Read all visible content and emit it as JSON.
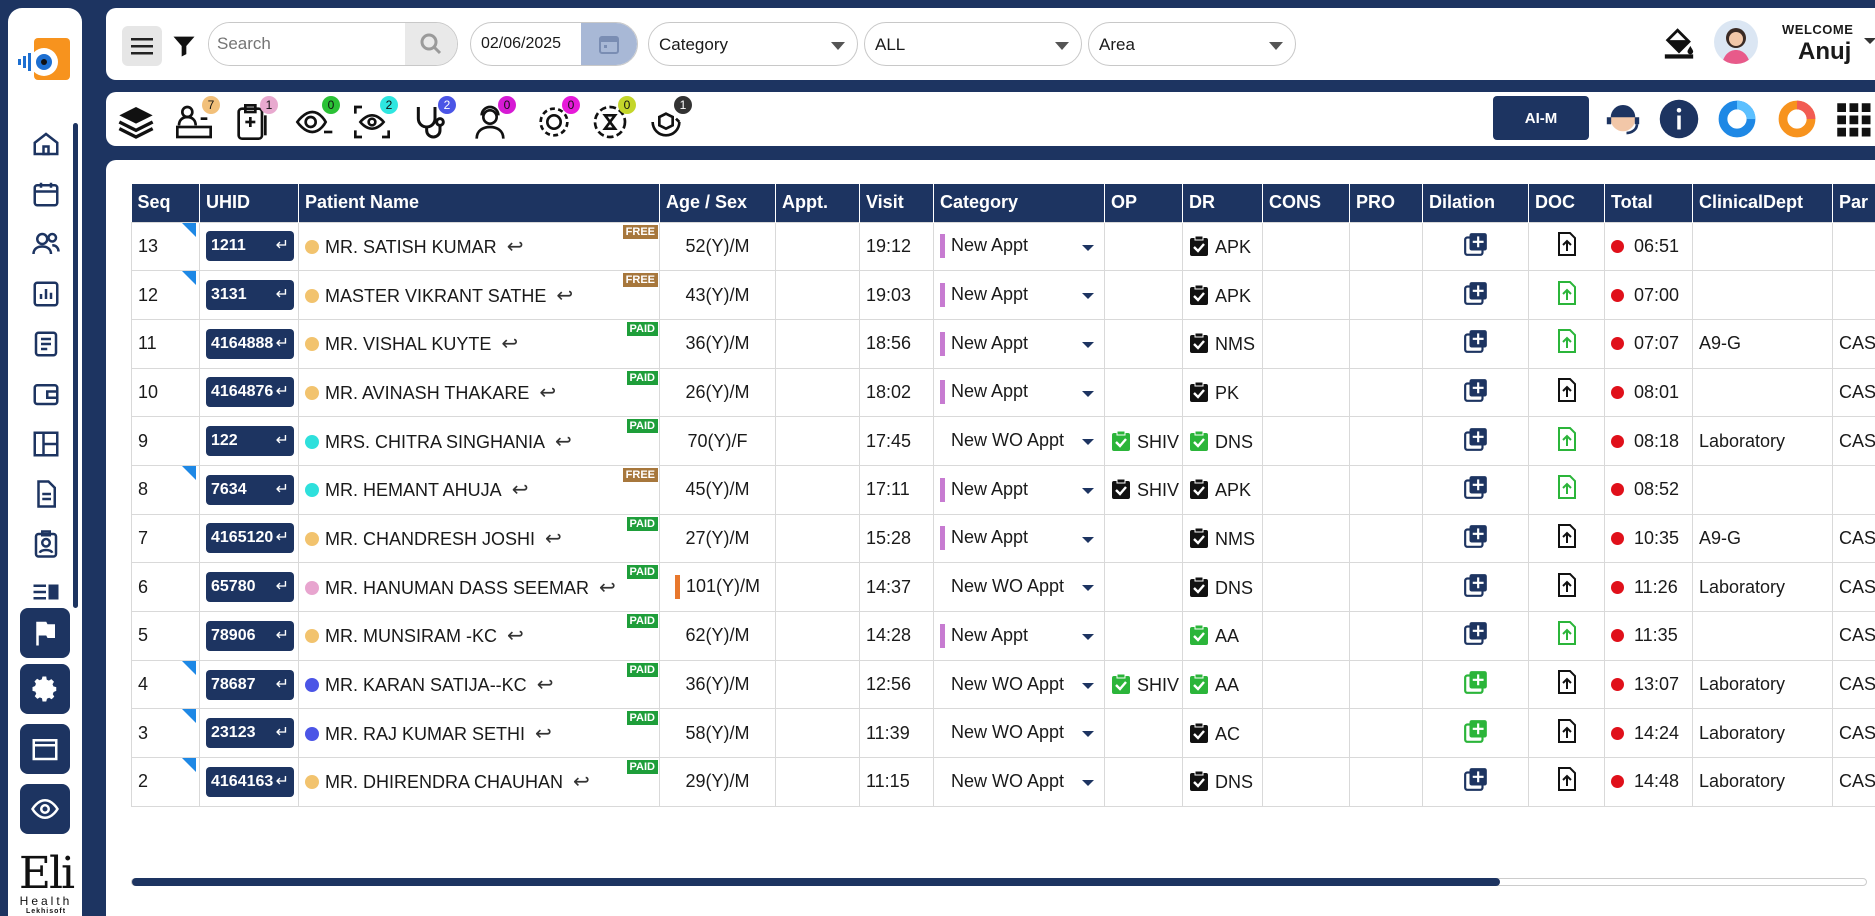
{
  "topbar": {
    "search_placeholder": "Search",
    "date": "02/06/2025",
    "category": "Category",
    "all": "ALL",
    "area": "Area",
    "welcome": "WELCOME",
    "user": "Anuj"
  },
  "toolbar": {
    "badges": [
      "7",
      "1",
      "0",
      "2",
      "2",
      "0",
      "0",
      "0",
      "1"
    ],
    "aim_label": "AI-M"
  },
  "columns": [
    "Seq",
    "UHID",
    "Patient Name",
    "Age / Sex",
    "Appt.",
    "Visit",
    "Category",
    "OP",
    "DR",
    "CONS",
    "PRO",
    "Dilation",
    "DOC",
    "Total",
    "ClinicalDept",
    "Par"
  ],
  "rows": [
    {
      "seq": "13",
      "uhid": "1211",
      "name": "MR. SATISH KUMAR",
      "fee": "FREE",
      "age": "52(Y)/M",
      "visit": "19:12",
      "cat": "New Appt",
      "op": "",
      "dr": "APK",
      "total": "06:51",
      "dept": "",
      "par": ""
    },
    {
      "seq": "12",
      "uhid": "3131",
      "name": "MASTER VIKRANT SATHE",
      "fee": "FREE",
      "age": "43(Y)/M",
      "visit": "19:03",
      "cat": "New Appt",
      "op": "",
      "dr": "APK",
      "total": "07:00",
      "dept": "",
      "par": ""
    },
    {
      "seq": "11",
      "uhid": "4164888",
      "name": "MR. VISHAL KUYTE",
      "fee": "PAID",
      "age": "36(Y)/M",
      "visit": "18:56",
      "cat": "New Appt",
      "op": "",
      "dr": "NMS",
      "total": "07:07",
      "dept": "A9-G",
      "par": "CAS"
    },
    {
      "seq": "10",
      "uhid": "4164876",
      "name": "MR. AVINASH THAKARE",
      "fee": "PAID",
      "age": "26(Y)/M",
      "visit": "18:02",
      "cat": "New Appt",
      "op": "",
      "dr": "PK",
      "total": "08:01",
      "dept": "",
      "par": "CAS"
    },
    {
      "seq": "9",
      "uhid": "122",
      "name": "MRS. CHITRA SINGHANIA",
      "fee": "PAID",
      "age": "70(Y)/F",
      "visit": "17:45",
      "cat": "New WO Appt",
      "op": "SHIV",
      "dr": "DNS",
      "total": "08:18",
      "dept": "Laboratory",
      "par": "CAS"
    },
    {
      "seq": "8",
      "uhid": "7634",
      "name": "MR. HEMANT AHUJA",
      "fee": "FREE",
      "age": "45(Y)/M",
      "visit": "17:11",
      "cat": "New Appt",
      "op": "SHIV",
      "dr": "APK",
      "total": "08:52",
      "dept": "",
      "par": ""
    },
    {
      "seq": "7",
      "uhid": "4165120",
      "name": "MR. CHANDRESH JOSHI",
      "fee": "PAID",
      "age": "27(Y)/M",
      "visit": "15:28",
      "cat": "New Appt",
      "op": "",
      "dr": "NMS",
      "total": "10:35",
      "dept": "A9-G",
      "par": "CAS"
    },
    {
      "seq": "6",
      "uhid": "65780",
      "name": "MR. HANUMAN DASS SEEMAR",
      "fee": "PAID",
      "age": "101(Y)/M",
      "visit": "14:37",
      "cat": "New WO Appt",
      "op": "",
      "dr": "DNS",
      "total": "11:26",
      "dept": "Laboratory",
      "par": "CAS"
    },
    {
      "seq": "5",
      "uhid": "78906",
      "name": "MR. MUNSIRAM -KC",
      "fee": "PAID",
      "age": "62(Y)/M",
      "visit": "14:28",
      "cat": "New Appt",
      "op": "",
      "dr": "AA",
      "total": "11:35",
      "dept": "",
      "par": "CAS"
    },
    {
      "seq": "4",
      "uhid": "78687",
      "name": "MR. KARAN SATIJA--KC",
      "fee": "PAID",
      "age": "36(Y)/M",
      "visit": "12:56",
      "cat": "New WO Appt",
      "op": "SHIV",
      "dr": "AA",
      "total": "13:07",
      "dept": "Laboratory",
      "par": "CAS"
    },
    {
      "seq": "3",
      "uhid": "23123",
      "name": "MR. RAJ KUMAR SETHI",
      "fee": "PAID",
      "age": "58(Y)/M",
      "visit": "11:39",
      "cat": "New WO Appt",
      "op": "",
      "dr": "AC",
      "total": "14:24",
      "dept": "Laboratory",
      "par": "CAS"
    },
    {
      "seq": "2",
      "uhid": "4164163",
      "name": "MR. DHIRENDRA CHAUHAN",
      "fee": "PAID",
      "age": "29(Y)/M",
      "visit": "11:15",
      "cat": "New WO Appt",
      "op": "",
      "dr": "DNS",
      "total": "14:48",
      "dept": "Laboratory",
      "par": "CAS"
    }
  ],
  "brand": {
    "name": "Eli",
    "tag": "Health",
    "company": "Lekhisoft"
  }
}
